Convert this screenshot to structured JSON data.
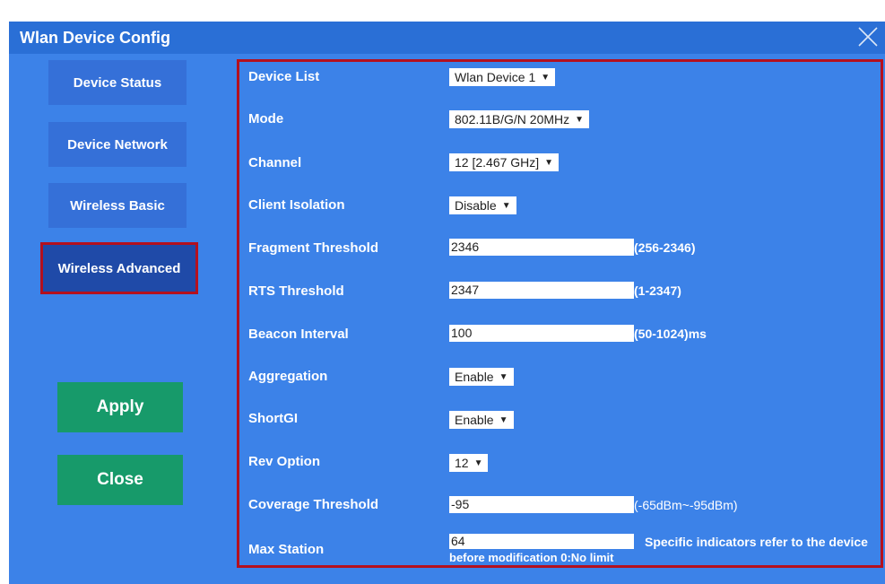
{
  "window": {
    "title": "Wlan Device Config"
  },
  "sidebar": {
    "items": [
      {
        "label": "Device Status"
      },
      {
        "label": "Device Network"
      },
      {
        "label": "Wireless Basic"
      },
      {
        "label": "Wireless Advanced",
        "active": true
      }
    ]
  },
  "actions": {
    "apply_label": "Apply",
    "close_label": "Close"
  },
  "form": {
    "device_list": {
      "label": "Device List",
      "value": "Wlan Device 1"
    },
    "mode": {
      "label": "Mode",
      "value": "802.11B/G/N 20MHz"
    },
    "channel": {
      "label": "Channel",
      "value": "12 [2.467 GHz]"
    },
    "client_isolation": {
      "label": "Client Isolation",
      "value": "Disable"
    },
    "fragment_threshold": {
      "label": "Fragment Threshold",
      "value": "2346",
      "hint": "(256-2346)"
    },
    "rts_threshold": {
      "label": "RTS Threshold",
      "value": "2347",
      "hint": "(1-2347)"
    },
    "beacon_interval": {
      "label": "Beacon Interval",
      "value": "100",
      "hint": "(50-1024)ms"
    },
    "aggregation": {
      "label": "Aggregation",
      "value": "Enable"
    },
    "short_gi": {
      "label": "ShortGI",
      "value": "Enable"
    },
    "rev_option": {
      "label": "Rev Option",
      "value": "12"
    },
    "coverage_threshold": {
      "label": "Coverage Threshold",
      "value": "-95",
      "hint": "(-65dBm~-95dBm)"
    },
    "max_station": {
      "label": "Max Station",
      "value": "64",
      "hint": "Specific indicators refer to the device",
      "hint2": "before modification 0:No limit"
    }
  },
  "colors": {
    "background": "#3c82e8",
    "titlebar": "#2a6fd6",
    "sidebar_button": "#3570d8",
    "sidebar_active": "#1f4aa8",
    "action_button": "#179a6a",
    "highlight_border": "#b4101e"
  }
}
